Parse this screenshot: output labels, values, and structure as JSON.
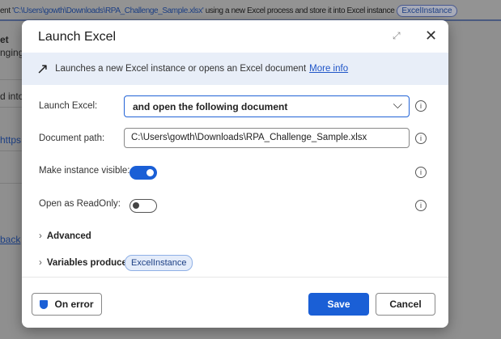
{
  "background": {
    "summary_prefix": "ent '",
    "summary_path": "C:\\Users\\gowth\\Downloads\\RPA_Challenge_Sample.xlsx'",
    "summary_suffix": " using a new Excel process and store it into Excel instance",
    "summary_variable": "ExcelInstance",
    "side_texts": [
      "et",
      "nging",
      "d into",
      "https:/",
      "back"
    ]
  },
  "dialog": {
    "title": "Launch Excel",
    "description": "Launches a new Excel instance or opens an Excel document",
    "more_info": "More info",
    "fields": {
      "launch_excel_label": "Launch Excel:",
      "launch_excel_value": "and open the following document",
      "document_path_label": "Document path:",
      "document_path_value": "C:\\Users\\gowth\\Downloads\\RPA_Challenge_Sample.xlsx",
      "visible_label": "Make instance visible:",
      "visible_on": true,
      "readonly_label": "Open as ReadOnly:",
      "readonly_on": false
    },
    "advanced": "Advanced",
    "variables_produced": "Variables produced",
    "variable": "ExcelInstance",
    "on_error": "On error",
    "save": "Save",
    "cancel": "Cancel"
  }
}
